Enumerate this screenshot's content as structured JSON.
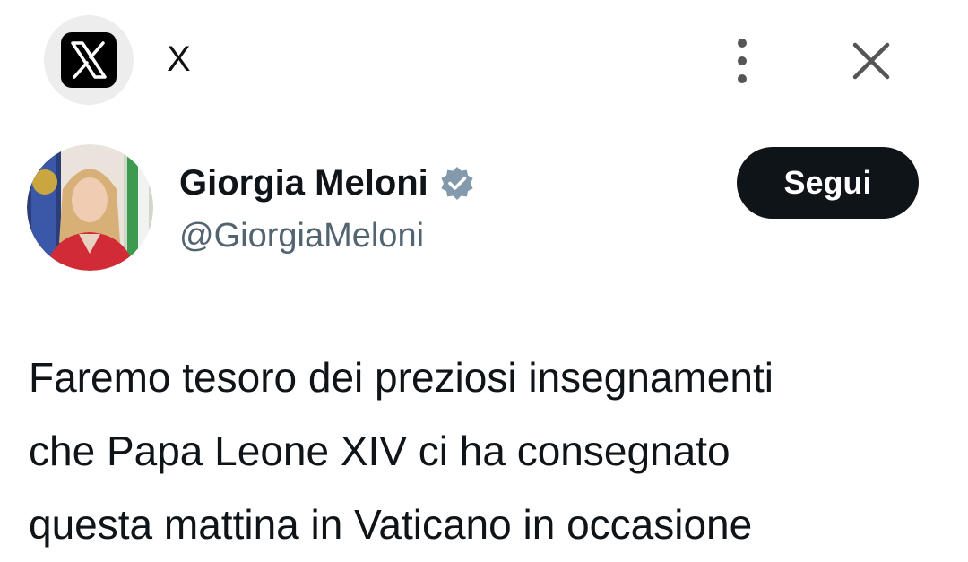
{
  "header": {
    "app_icon": "x-logo-icon",
    "title": "X",
    "more_icon": "vertical-ellipsis-icon",
    "close_icon": "close-icon"
  },
  "profile": {
    "display_name": "Giorgia Meloni",
    "handle": "@GiorgiaMeloni",
    "verified_icon": "verified-badge-icon",
    "follow_label": "Segui"
  },
  "tweet": {
    "lines": [
      "Faremo tesoro dei preziosi insegnamenti",
      "che Papa Leone XIV ci ha consegnato",
      "questa mattina in Vaticano in occasione"
    ]
  },
  "colors": {
    "text_primary": "#0f1419",
    "text_secondary": "#536471",
    "button_bg": "#0f1419",
    "verified_badge": "#829aab"
  }
}
